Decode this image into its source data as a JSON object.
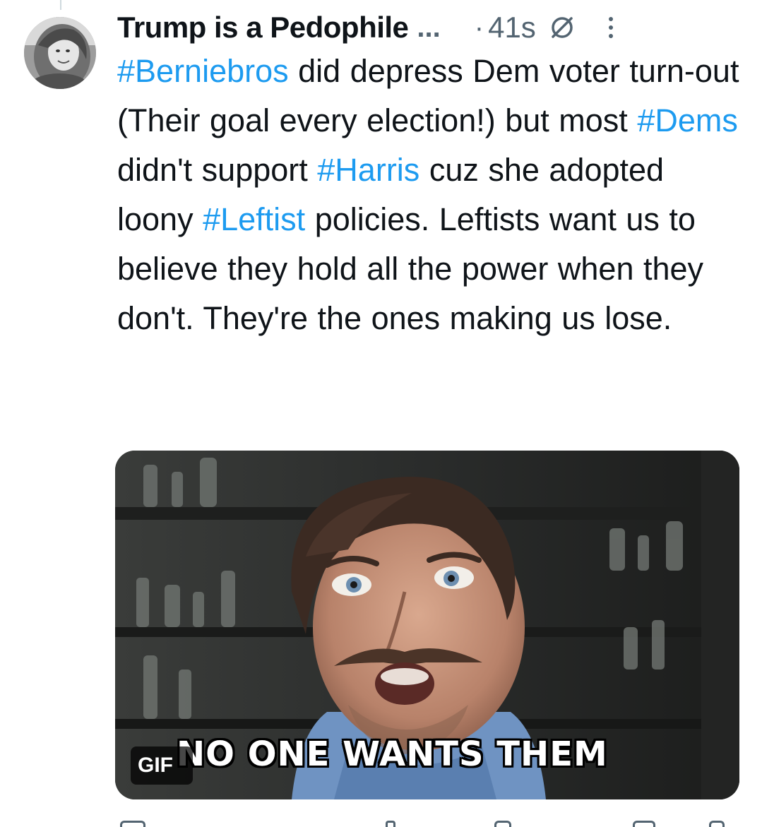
{
  "tweet": {
    "display_name": "Trump is a Pedophile",
    "name_truncation": "...",
    "separator": "·",
    "timestamp": "41s",
    "text_segments": [
      {
        "text": "#Berniebros",
        "hashtag": true
      },
      {
        "text": " did depress Dem voter turn-out (Their goal every election!) but most ",
        "hashtag": false
      },
      {
        "text": "#Dems",
        "hashtag": true
      },
      {
        "text": " didn't support ",
        "hashtag": false
      },
      {
        "text": "#Harris",
        "hashtag": true
      },
      {
        "text": " cuz she adopted loony ",
        "hashtag": false
      },
      {
        "text": "#Leftist",
        "hashtag": true
      },
      {
        "text": " policies. Leftists want us to believe they hold all the power when they don't. They're the ones making us lose.",
        "hashtag": false
      }
    ],
    "media": {
      "caption": "NO ONE WANTS THEM",
      "badge": "GIF"
    }
  },
  "icons": {
    "no_reply": "no-reply-icon",
    "more": "more-options-icon"
  },
  "colors": {
    "hashtag": "#1d9bf0",
    "text": "#0f1419",
    "secondary": "#536471"
  }
}
